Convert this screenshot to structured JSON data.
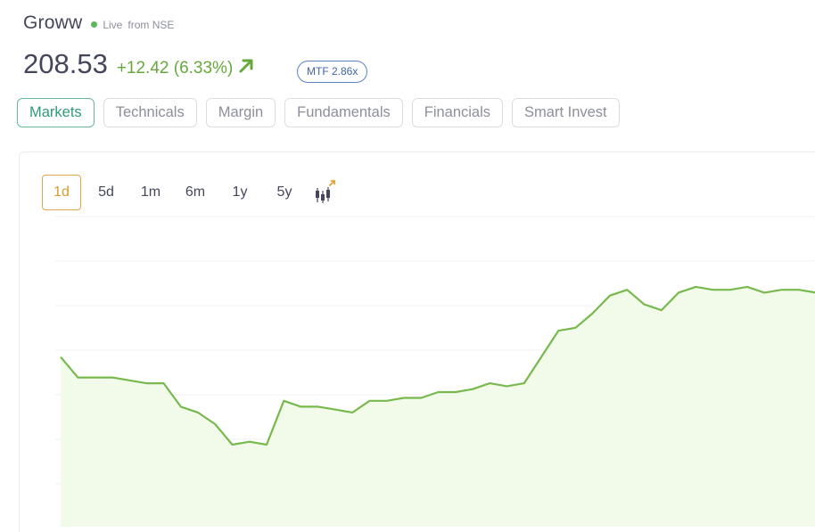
{
  "header": {
    "stock_name": "Groww",
    "live_label": "Live",
    "live_source": "from NSE",
    "live_color": "#5cb85c"
  },
  "price": {
    "integer_part": "208.",
    "decimal_part": "53",
    "change": "+12.42 (6.33%)",
    "change_color": "#66a83c",
    "trend_icon": "arrow-up-right-icon",
    "mtf_badge": "MTF 2.86x"
  },
  "tabs": [
    {
      "label": "Markets",
      "active": true
    },
    {
      "label": "Technicals",
      "active": false
    },
    {
      "label": "Margin",
      "active": false
    },
    {
      "label": "Fundamentals",
      "active": false
    },
    {
      "label": "Financials",
      "active": false
    },
    {
      "label": "Smart Invest",
      "active": false
    }
  ],
  "ranges": [
    {
      "label": "1d",
      "active": true
    },
    {
      "label": "5d",
      "active": false
    },
    {
      "label": "1m",
      "active": false
    },
    {
      "label": "6m",
      "active": false
    },
    {
      "label": "1y",
      "active": false
    },
    {
      "label": "5y",
      "active": false
    }
  ],
  "chart_icon": "candlestick-chart-icon",
  "chart_data": {
    "type": "area",
    "line_color": "#78b94e",
    "fill_color": "#f2fbe9",
    "grid": true,
    "ylim": [
      0,
      100
    ],
    "series": [
      {
        "values": [
          55,
          48,
          48,
          48,
          47,
          46,
          46,
          38,
          36,
          32,
          25,
          26,
          25,
          40,
          38,
          38,
          37,
          36,
          40,
          40,
          41,
          41,
          43,
          43,
          44,
          46,
          45,
          46,
          55,
          64,
          65,
          70,
          76,
          78,
          73,
          71,
          77,
          79,
          78,
          78,
          79,
          77,
          78,
          78,
          77
        ]
      }
    ]
  }
}
